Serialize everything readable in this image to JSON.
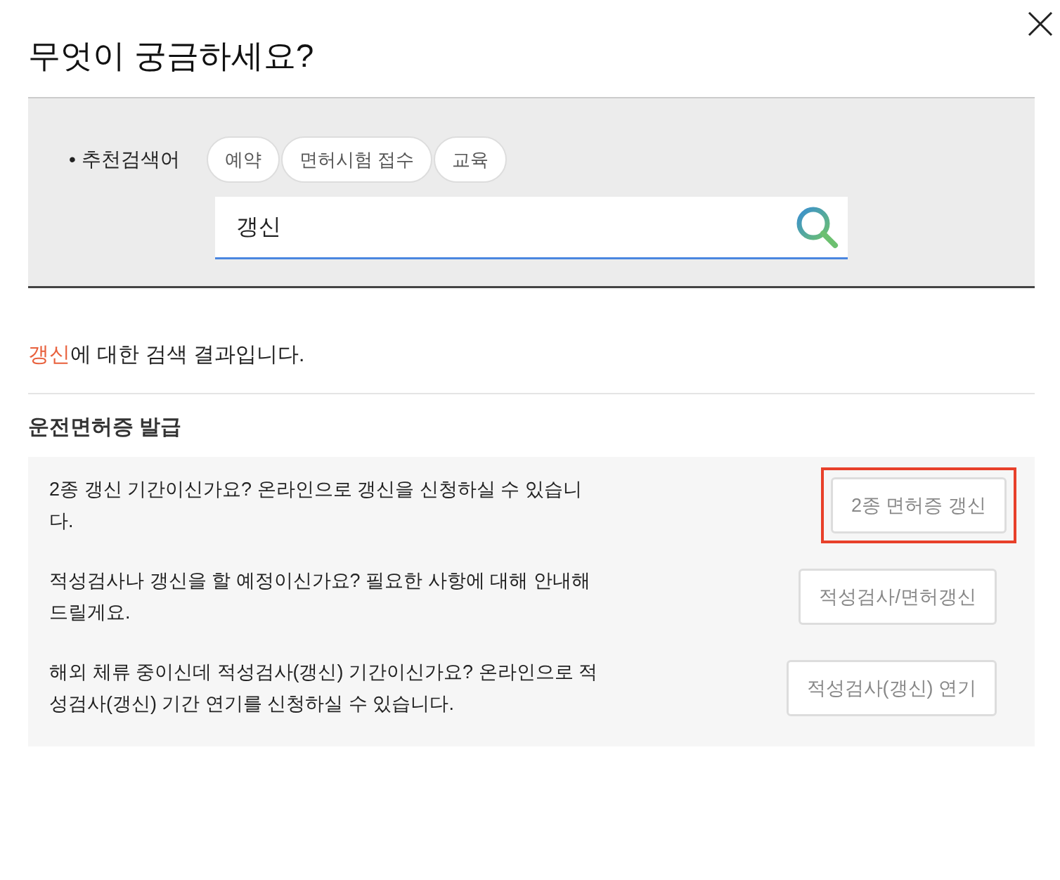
{
  "dialog": {
    "title": "무엇이 궁금하세요?"
  },
  "recommended": {
    "label": "• 추천검색어",
    "keywords": [
      "예약",
      "면허시험 접수",
      "교육"
    ]
  },
  "search": {
    "value": "갱신"
  },
  "result_summary": "**갱신**에 대한 검색 결과입니다.",
  "section": {
    "title": "운전면허증 발급",
    "items": [
      {
        "text": "2종 갱신 기간이신가요? 온라인으로 갱신을 신청하실 수 있습니다.",
        "button": "2종 면허증 갱신",
        "highlighted": true
      },
      {
        "text": "적성검사나 갱신을 할 예정이신가요? 필요한 사항에 대해 안내해드릴게요.",
        "button": "적성검사/면허갱신",
        "highlighted": false
      },
      {
        "text": "해외 체류 중이신데 적성검사(갱신) 기간이신가요? 온라인으로 적성검사(갱신) 기간 연기를 신청하실 수 있습니다.",
        "button": "적성검사(갱신) 연기",
        "highlighted": false
      }
    ]
  }
}
